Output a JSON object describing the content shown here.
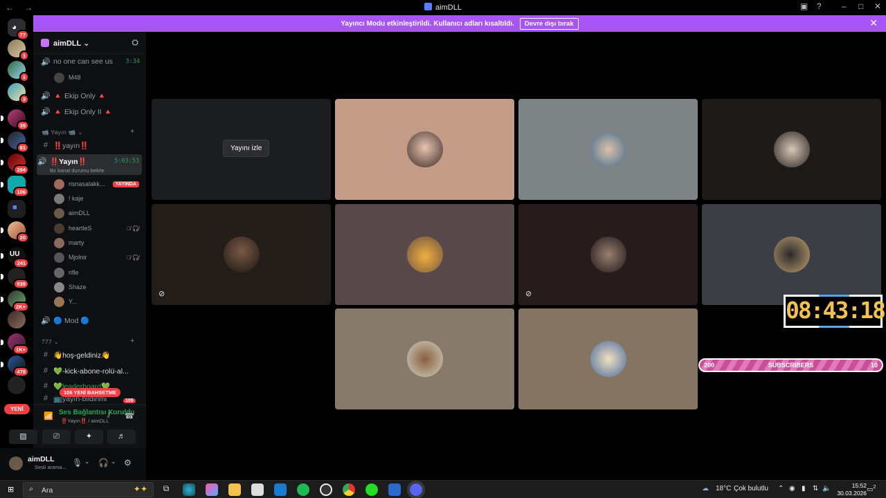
{
  "window": {
    "title": "aimDLL",
    "back": "←",
    "forward": "→"
  },
  "banner": {
    "text": "Yayıncı Modu etkinleştirildi. Kullanıcı adları kısaltıldı.",
    "button": "Devre dışı bırak"
  },
  "guilds": {
    "badges": [
      "77",
      "1",
      "1",
      "3",
      "35",
      "81",
      "294",
      "106",
      "",
      "20",
      "241",
      "939",
      "2K+",
      "1K+",
      "478",
      ""
    ],
    "new_label": "YENİ"
  },
  "server": {
    "name": "aimDLL"
  },
  "channels": {
    "top": [
      {
        "name": "no one can see us",
        "time": "3:34"
      },
      {
        "member": "M48"
      },
      {
        "name": "🔺 Ekip Only 🔺"
      },
      {
        "name": "🔺 Ekip Only II 🔺"
      }
    ],
    "category_stream": "📹 Yayın 📹",
    "text_yayin": "‼️yayın‼️",
    "voice_yayin": {
      "name": "‼️Yayın‼️",
      "time": "5:03:53",
      "status": "Bir kanal durumu belirle"
    },
    "members": [
      {
        "name": "risnasalakk...",
        "live": "YAYINDA",
        "color": "#a06a5a"
      },
      {
        "name": "! kaje",
        "color": "#7a7a7a"
      },
      {
        "name": "aimDLL",
        "color": "#6b5a49"
      },
      {
        "name": "heartleS",
        "muted": "🎙̸ 🎧̸",
        "color": "#4a3a30"
      },
      {
        "name": "marty",
        "color": "#8a6a5a"
      },
      {
        "name": "Mjolnir",
        "muted": "🎙̸ 🎧̸",
        "color": "#555"
      },
      {
        "name": "rifle",
        "color": "#666"
      },
      {
        "name": "Shaze",
        "color": "#888"
      },
      {
        "name": "Y...",
        "color": "#997755"
      }
    ],
    "mod": "🔵 Mod 🔵",
    "category_777": "777",
    "text_list": [
      "👋hoş-geldiniz👋",
      "💚-kick-abone-rolü-al...",
      "💚leaderboard💚",
      "📺yayın-bildirimi"
    ],
    "mention_new": "106 YENİ BAHSETME",
    "mention_count": "105"
  },
  "voice_panel": {
    "status": "Ses Bağlantısı Kuruldu",
    "sub": "‼️Yayın‼️ / aimDLL"
  },
  "user_panel": {
    "name": "aimDLL",
    "status": "Sesli arama..."
  },
  "stage": {
    "watch_label": "Yayını izle",
    "clock": "08:43:18",
    "subs_left": "200",
    "subs_label": "SUBSCRIBERS",
    "subs_right": "10"
  },
  "taskbar": {
    "search_placeholder": "Ara",
    "weather": "18°C",
    "weather_text": "Çok bulutlu",
    "time": "15:52",
    "date": "30.03.2026",
    "notif": "2"
  }
}
